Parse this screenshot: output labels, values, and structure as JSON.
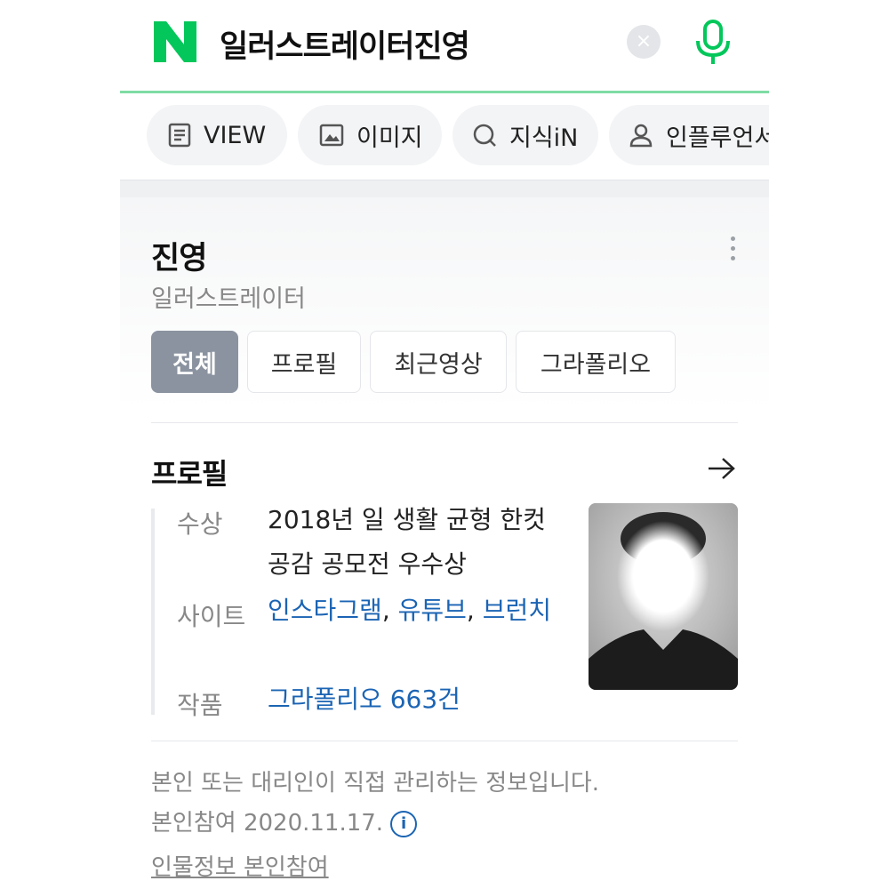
{
  "search": {
    "logo_letter": "N",
    "query": "일러스트레이터진영",
    "clear_symbol": "×",
    "brand_color": "#03c75a"
  },
  "tabs": [
    {
      "label": "VIEW",
      "icon": "document-icon"
    },
    {
      "label": "이미지",
      "icon": "image-icon"
    },
    {
      "label": "지식iN",
      "icon": "q-search-icon"
    },
    {
      "label": "인플루언서",
      "icon": "person-icon"
    }
  ],
  "profile": {
    "name": "진영",
    "job": "일러스트레이터",
    "tabs": [
      "전체",
      "프로필",
      "최근영상",
      "그라폴리오"
    ],
    "active_tab": "전체"
  },
  "section": {
    "title": "프로필",
    "rows": [
      {
        "label": "수상",
        "value": "2018년 일 생활 균형 한컷 공감 공모전 우수상"
      },
      {
        "label": "사이트",
        "links": [
          "인스타그램",
          "유튜브",
          "브런치"
        ]
      },
      {
        "label": "작품",
        "link": "그라폴리오 663건"
      }
    ]
  },
  "footer": {
    "notice": "본인 또는 대리인이 직접 관리하는 정보입니다.",
    "participation": "본인참여 2020.11.17.",
    "info_symbol": "i",
    "edit_link": "인물정보 본인참여"
  }
}
